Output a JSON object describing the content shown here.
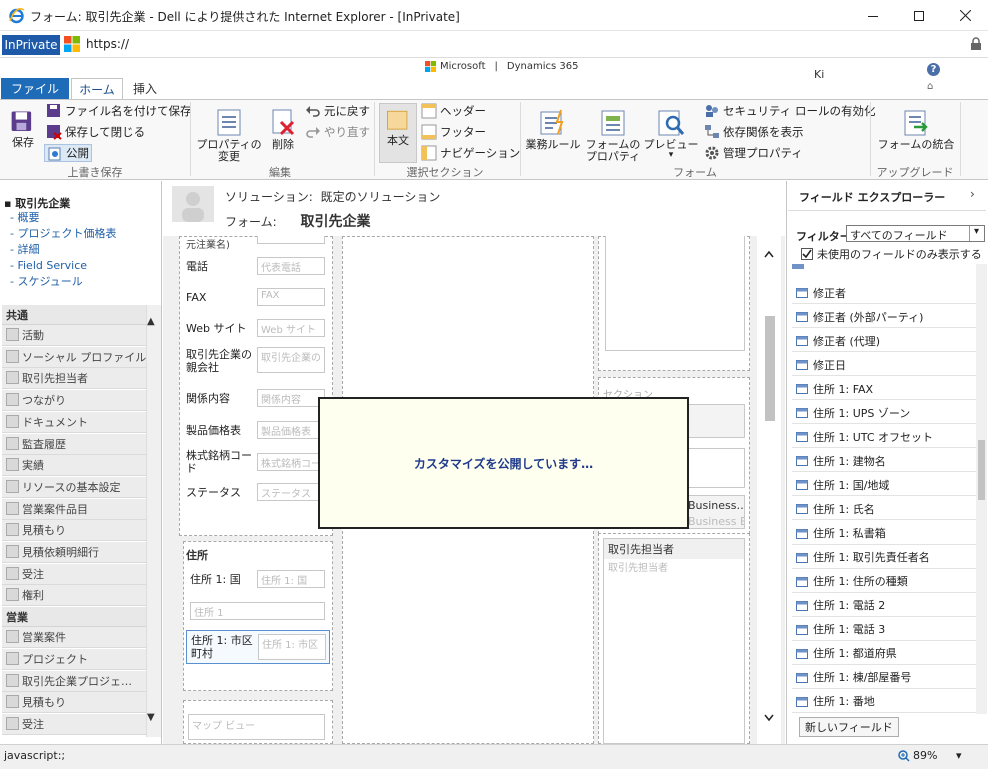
{
  "window": {
    "title": "フォーム: 取引先企業 - Dell により提供された Internet Explorer - [InPrivate]",
    "minimize": "—",
    "maximize": "☐",
    "close": "✕"
  },
  "address_bar": {
    "inprivate": "InPrivate",
    "url": "https://"
  },
  "brand": {
    "microsoft": "Microsoft",
    "separator": "|",
    "product": "Dynamics 365",
    "user": "Ki",
    "help": "?",
    "collapse": "⌂"
  },
  "ribbon": {
    "tabs": {
      "file": "ファイル",
      "home": "ホーム",
      "insert": "挿入"
    },
    "save": {
      "save": "保存",
      "save_as": "ファイル名を付けて保存",
      "save_close": "保存して閉じる",
      "publish": "公開",
      "group": "上書き保存"
    },
    "edit": {
      "properties": [
        "プロパティの",
        "変更"
      ],
      "delete": "削除",
      "undo": "元に戻す",
      "redo": "やり直す",
      "group": "編集"
    },
    "select": {
      "body": "本文",
      "header": "ヘッダー",
      "footer": "フッター",
      "navigation": "ナビゲーション",
      "group": "選択セクション"
    },
    "form": {
      "business_rules": "業務ルール",
      "form_properties": [
        "フォームの",
        "プロパティ"
      ],
      "preview": "プレビュー",
      "preview_arrow": "▾",
      "enable_security": "セキュリティ ロールの有効化",
      "show_dependencies": "依存関係を表示",
      "managed_properties": "管理プロパティ",
      "group": "フォーム"
    },
    "upgrade": {
      "merge_forms": "フォームの統合",
      "group": "アップグレード"
    }
  },
  "leftnav": {
    "entity": "取引先企業",
    "links": [
      "概要",
      "プロジェクト価格表",
      "詳細",
      "Field Service",
      "スケジュール"
    ],
    "groups": [
      {
        "label": "共通",
        "items": [
          "活動",
          "ソーシャル プロファイル",
          "取引先担当者",
          "つながり",
          "ドキュメント",
          "監査履歴",
          "実績",
          "リソースの基本設定",
          "営業案件品目",
          "見積もり",
          "見積依頼明細行",
          "受注",
          "権利"
        ]
      },
      {
        "label": "営業",
        "items": [
          "営業案件",
          "プロジェクト",
          "取引先企業プロジェ…",
          "見積もり",
          "受注"
        ]
      }
    ],
    "scroll_up": "▲",
    "scroll_down": "▼"
  },
  "form_header": {
    "solution_label": "ソリューション:",
    "solution_value": "既定のソリューション",
    "form_label": "フォーム:",
    "form_value": "取引先企業"
  },
  "form": {
    "partial_label": "元注業名)",
    "fields": [
      {
        "label": "電話",
        "placeholder": "代表電話"
      },
      {
        "label": "FAX",
        "placeholder": "FAX"
      },
      {
        "label": "Web サイト",
        "placeholder": "Web サイト"
      },
      {
        "label": "取引先企業の親会社",
        "placeholder": "取引先企業の"
      },
      {
        "label": "関係内容",
        "placeholder": "関係内容"
      },
      {
        "label": "製品価格表",
        "placeholder": "製品価格表"
      },
      {
        "label": "株式銘柄コード",
        "placeholder": "株式銘柄コー"
      },
      {
        "label": "ステータス",
        "placeholder": "ステータス"
      }
    ],
    "address_section": "住所",
    "address_fields": [
      {
        "label": "住所 1: 国",
        "placeholder": "住所 1: 国"
      },
      {
        "label": "",
        "placeholder": "住所 1"
      },
      {
        "label": "住所 1: 市区町村",
        "placeholder": "住所 1: 市区"
      }
    ],
    "map_placeholder": "マップ ビュー",
    "right_section": "セクション",
    "business_label": "Business…",
    "business_placeholder": "Business E",
    "contacts_label": "取引先担当者",
    "contacts_placeholder": "取引先担当者"
  },
  "modal": {
    "message": "カスタマイズを公開しています…"
  },
  "field_explorer": {
    "title": "フィールド エクスプローラー",
    "filter_label": "フィルター",
    "filter_value": "すべてのフィールド",
    "unused_only": "未使用のフィールドのみ表示する",
    "items": [
      "修正者",
      "修正者 (外部パーティ)",
      "修正者 (代理)",
      "修正日",
      "住所 1: FAX",
      "住所 1: UPS ゾーン",
      "住所 1: UTC オフセット",
      "住所 1: 建物名",
      "住所 1: 国/地域",
      "住所 1: 氏名",
      "住所 1: 私書箱",
      "住所 1: 取引先責任者名",
      "住所 1: 住所の種類",
      "住所 1: 電話 2",
      "住所 1: 電話 3",
      "住所 1: 都道府県",
      "住所 1: 棟/部屋番号",
      "住所 1: 番地"
    ],
    "new_field": "新しいフィールド"
  },
  "statusbar": {
    "text": "javascript:;",
    "zoom": "89%",
    "zoom_arrow": "▾"
  },
  "colors": {
    "accent": "#1e6bb8",
    "inprivate": "#1e5aa8",
    "link": "#1f5fa8"
  }
}
